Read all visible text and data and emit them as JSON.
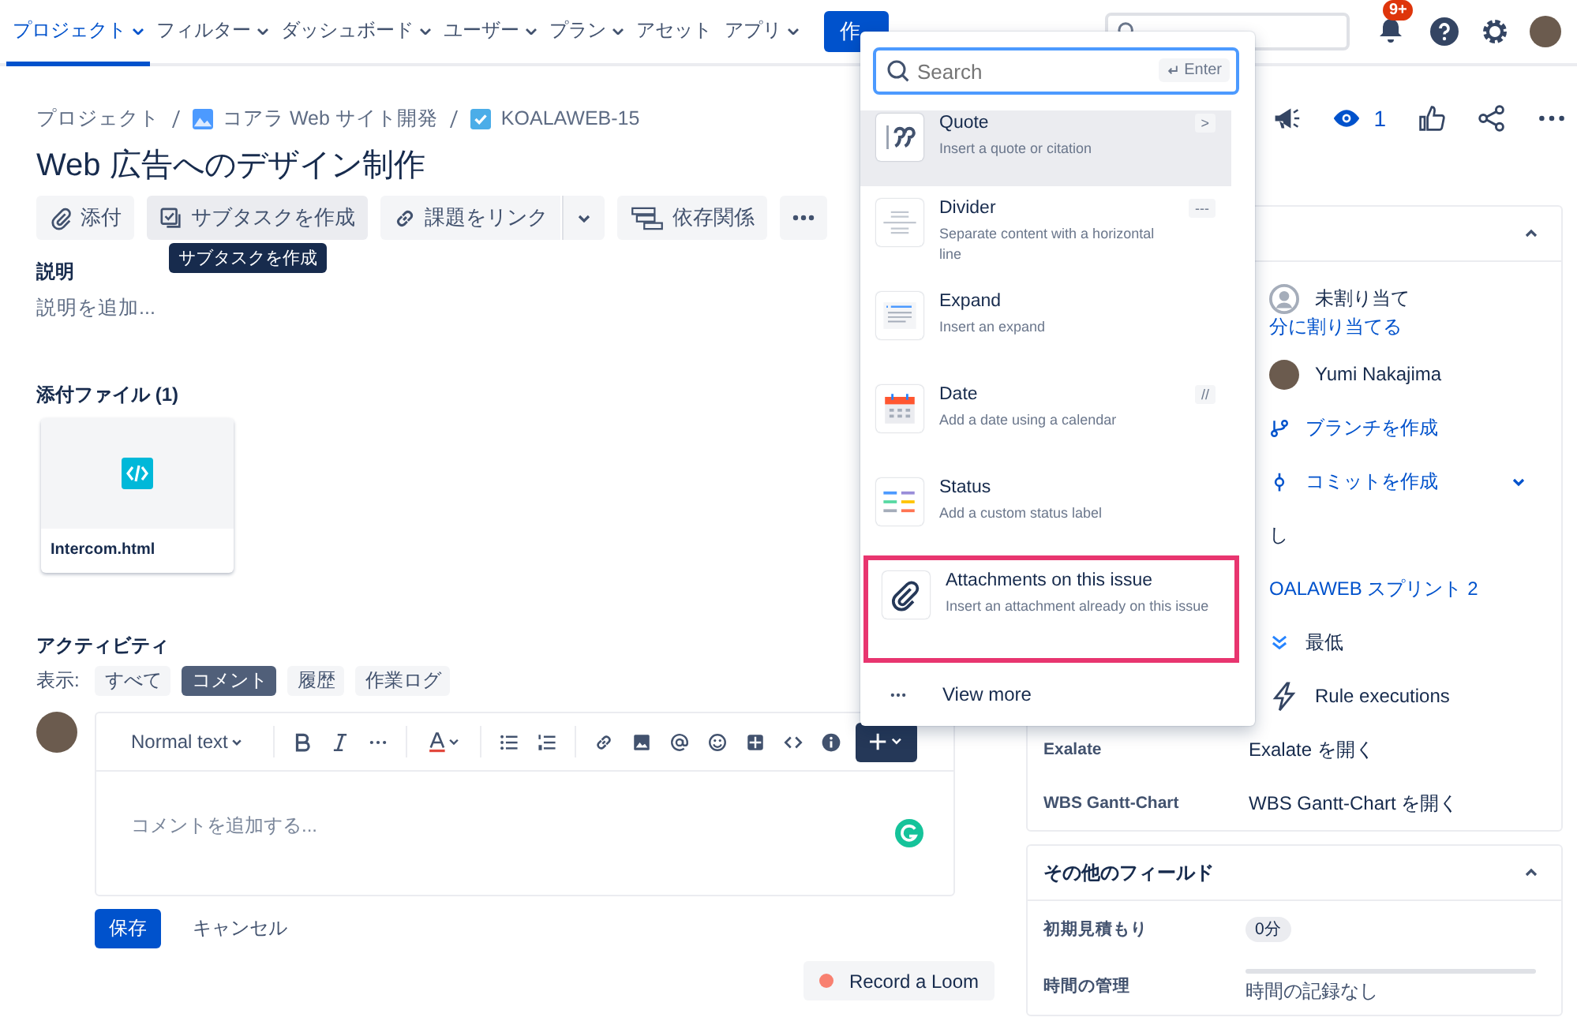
{
  "nav": {
    "items": [
      {
        "label": "プロジェクト",
        "selected": true,
        "dropdown": true
      },
      {
        "label": "フィルター",
        "selected": false,
        "dropdown": true
      },
      {
        "label": "ダッシュボード",
        "selected": false,
        "dropdown": true
      },
      {
        "label": "ユーザー",
        "selected": false,
        "dropdown": true
      },
      {
        "label": "プラン",
        "selected": false,
        "dropdown": true
      },
      {
        "label": "アセット",
        "selected": false,
        "dropdown": false
      },
      {
        "label": "アプリ",
        "selected": false,
        "dropdown": true
      }
    ],
    "create_button": "作",
    "notification_badge": "9+"
  },
  "breadcrumbs": [
    "プロジェクト",
    "コアラ Web サイト開発",
    "KOALAWEB-15"
  ],
  "issue_title": "Web 広告へのデザイン制作",
  "toolbar": [
    {
      "kind": "attach",
      "label": "添付"
    },
    {
      "kind": "subtask",
      "label": "サブタスクを作成"
    },
    {
      "kind": "link",
      "label": "課題をリンク"
    },
    {
      "kind": "dependency",
      "label": "依存関係"
    }
  ],
  "tooltip": "サブタスクを作成",
  "watch_count": "1",
  "description": {
    "heading": "説明",
    "placeholder": "説明を追加..."
  },
  "attachments": {
    "heading": "添付ファイル (1)",
    "files": [
      "Intercom.html"
    ]
  },
  "activity": {
    "heading": "アクティビティ",
    "show_label": "表示:",
    "filters": [
      {
        "label": "すべて",
        "selected": false
      },
      {
        "label": "コメント",
        "selected": true
      },
      {
        "label": "履歴",
        "selected": false
      },
      {
        "label": "作業ログ",
        "selected": false
      }
    ]
  },
  "editor": {
    "text_style": "Normal text",
    "placeholder": "コメントを追加する...",
    "save": "保存",
    "cancel": "キャンセル"
  },
  "record_loom": "Record a Loom",
  "insert_menu": {
    "search": {
      "placeholder": "Search",
      "hint": "Enter"
    },
    "items": [
      {
        "kind": "quote",
        "title": "Quote",
        "description": "Insert a quote or citation",
        "shortcut": ">",
        "selected": true,
        "annotated": false
      },
      {
        "kind": "divider",
        "title": "Divider",
        "description": "Separate content with a horizontal line",
        "shortcut": "---",
        "selected": false,
        "annotated": false
      },
      {
        "kind": "expand",
        "title": "Expand",
        "description": "Insert an expand",
        "selected": false,
        "annotated": false
      },
      {
        "kind": "date",
        "title": "Date",
        "description": "Add a date using a calendar",
        "shortcut": "//",
        "selected": false,
        "annotated": false
      },
      {
        "kind": "status",
        "title": "Status",
        "description": "Add a custom status label",
        "selected": false,
        "annotated": false
      },
      {
        "kind": "attachment",
        "title": "Attachments on this issue",
        "description": "Insert an attachment already on this issue",
        "selected": false,
        "annotated": true
      }
    ],
    "view_more": "View more"
  },
  "details": {
    "rows": [
      {
        "kind": "unassigned",
        "value": "未割り当て"
      },
      {
        "kind": "link",
        "value": "分に割り当てる"
      },
      {
        "kind": "person",
        "value": "Yumi Nakajima"
      },
      {
        "kind": "branch",
        "value": "ブランチを作成"
      },
      {
        "kind": "commit",
        "value": "コミットを作成"
      },
      {
        "kind": "plain",
        "value": "し"
      },
      {
        "kind": "link",
        "value": "OALAWEB スプリント 2"
      },
      {
        "kind": "priority",
        "value": "最低"
      },
      {
        "kind": "automation",
        "value": "Rule executions"
      },
      {
        "kind": "app",
        "label": "Exalate",
        "value": "Exalate を開く"
      },
      {
        "kind": "app",
        "label": "WBS Gantt-Chart",
        "value": "WBS Gantt-Chart を開く"
      }
    ]
  },
  "other_fields": {
    "heading": "その他のフィールド",
    "rows": [
      {
        "kind": "badge",
        "label": "初期見積もり",
        "value": "0分"
      },
      {
        "kind": "time",
        "label": "時間の管理",
        "value": "時間の記録なし",
        "level": 0
      }
    ]
  }
}
